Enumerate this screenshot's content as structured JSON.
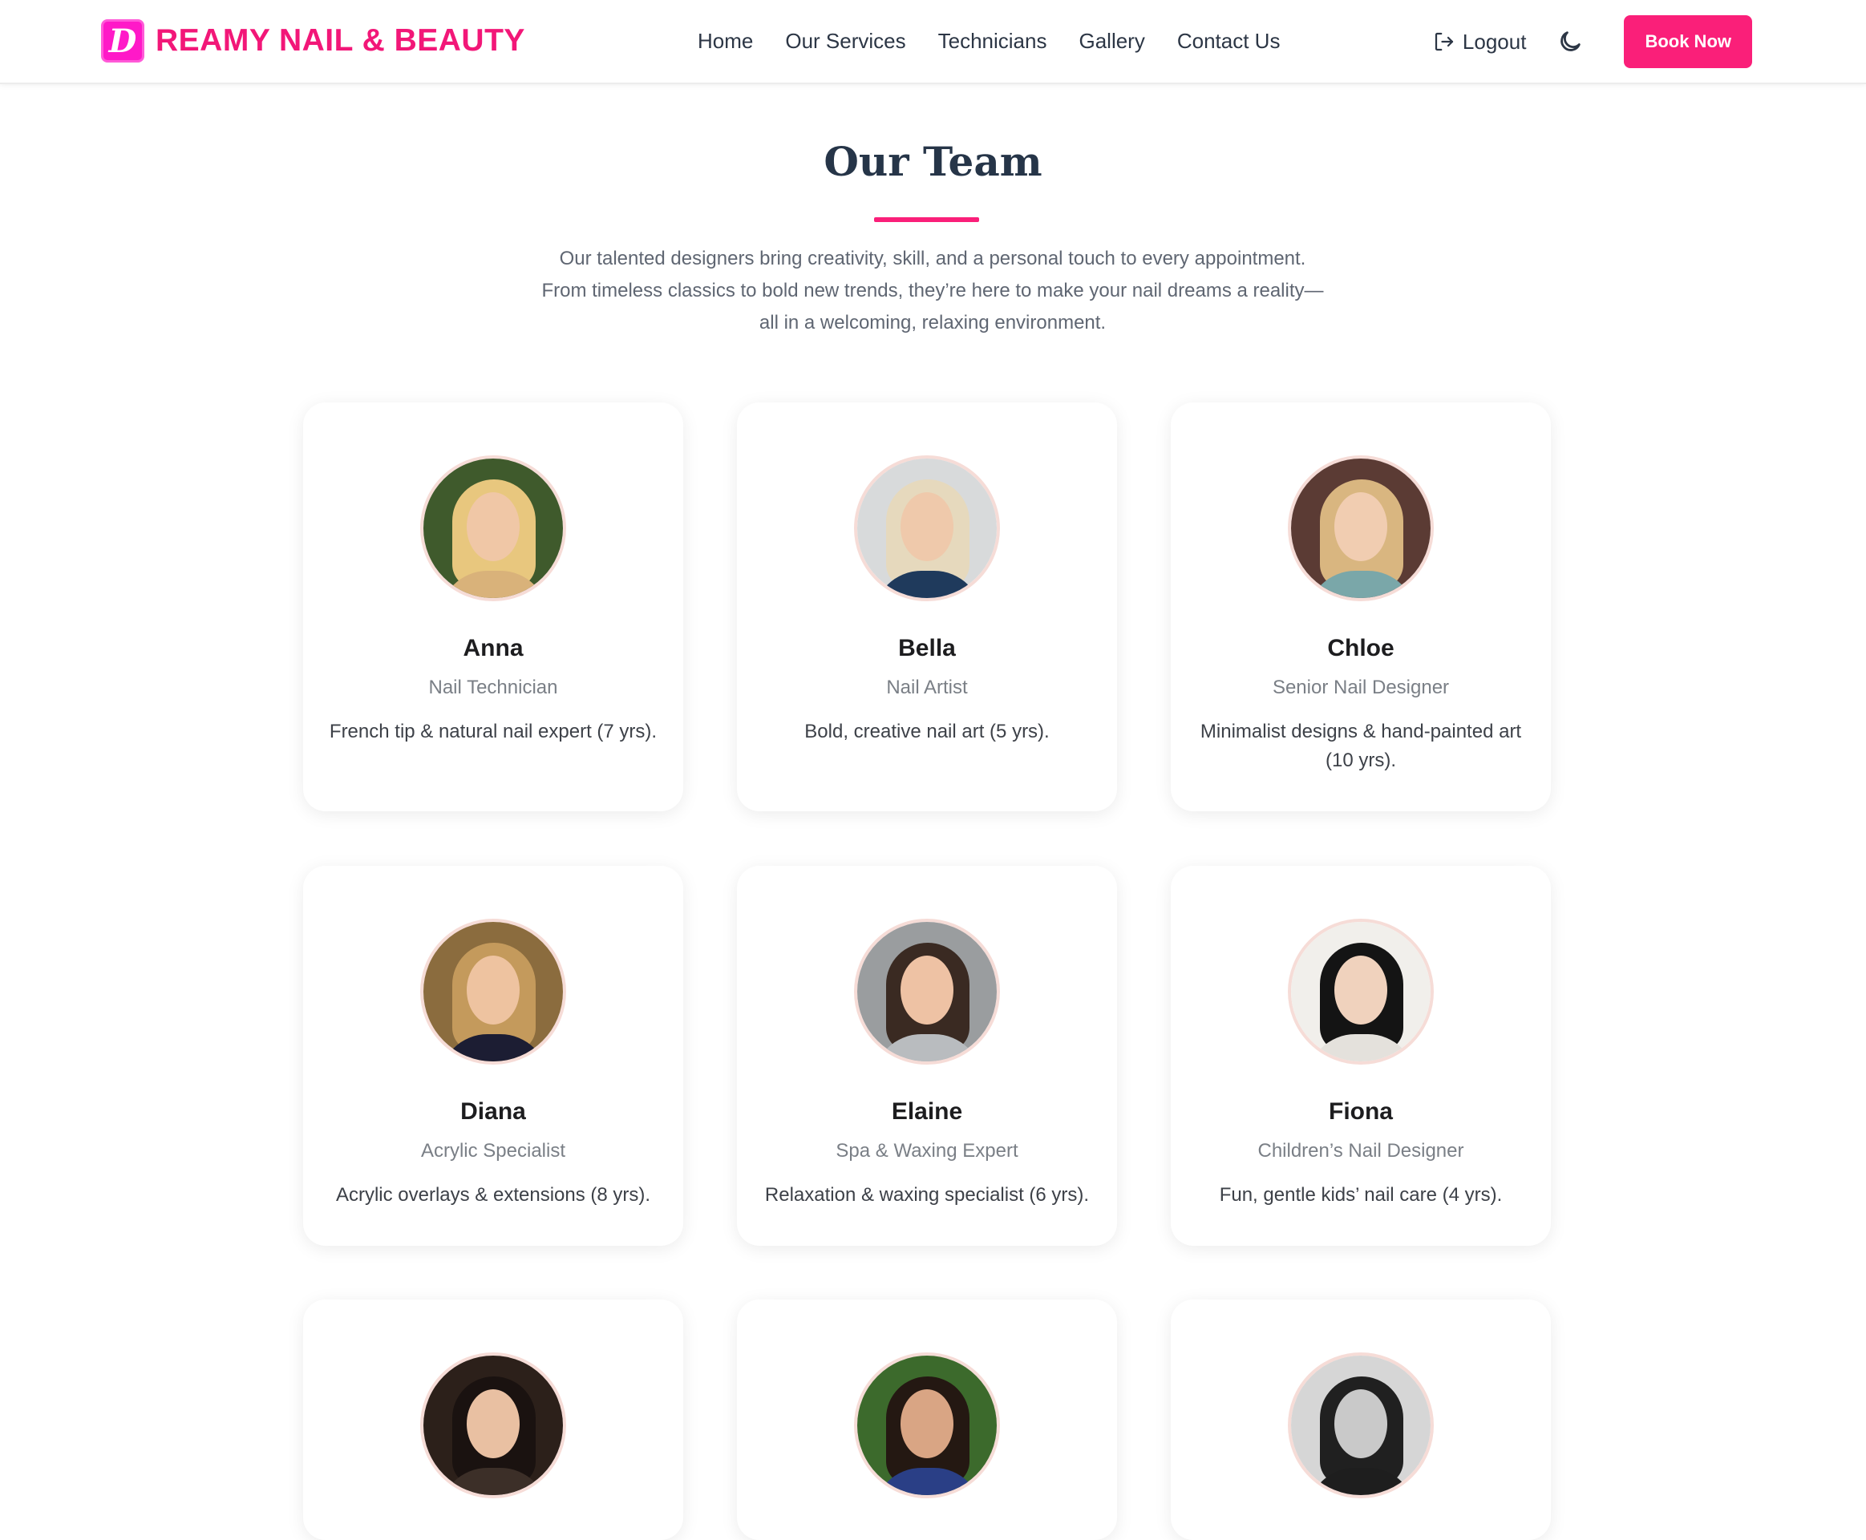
{
  "header": {
    "brand_initial": "D",
    "brand_name": "REAMY NAIL & BEAUTY",
    "nav": [
      "Home",
      "Our Services",
      "Technicians",
      "Gallery",
      "Contact Us"
    ],
    "logout_label": "Logout",
    "logout_icon": "logout-icon",
    "theme_icon": "moon-icon",
    "book_label": "Book Now"
  },
  "section": {
    "title": "Our Team",
    "intro": [
      "Our talented designers bring creativity, skill, and a personal touch to every appointment.",
      "From timeless classics to bold new trends, they’re here to make your nail dreams a reality—",
      "all in a welcoming, relaxing environment."
    ]
  },
  "team": [
    {
      "name": "Anna",
      "role": "Nail Technician",
      "bio": "French tip & natural nail expert (7 yrs)."
    },
    {
      "name": "Bella",
      "role": "Nail Artist",
      "bio": "Bold, creative nail art (5 yrs)."
    },
    {
      "name": "Chloe",
      "role": "Senior Nail Designer",
      "bio": "Minimalist designs & hand-painted art (10 yrs)."
    },
    {
      "name": "Diana",
      "role": "Acrylic Specialist",
      "bio": "Acrylic overlays & extensions (8 yrs)."
    },
    {
      "name": "Elaine",
      "role": "Spa & Waxing Expert",
      "bio": "Relaxation & waxing specialist (6 yrs)."
    },
    {
      "name": "Fiona",
      "role": "Children’s Nail Designer",
      "bio": "Fun, gentle kids’ nail care (4 yrs)."
    }
  ],
  "colors": {
    "brand_pink": "#f21778",
    "button_pink": "#fa1f79",
    "logo_magenta": "#ff19c8",
    "heading": "#263548"
  }
}
